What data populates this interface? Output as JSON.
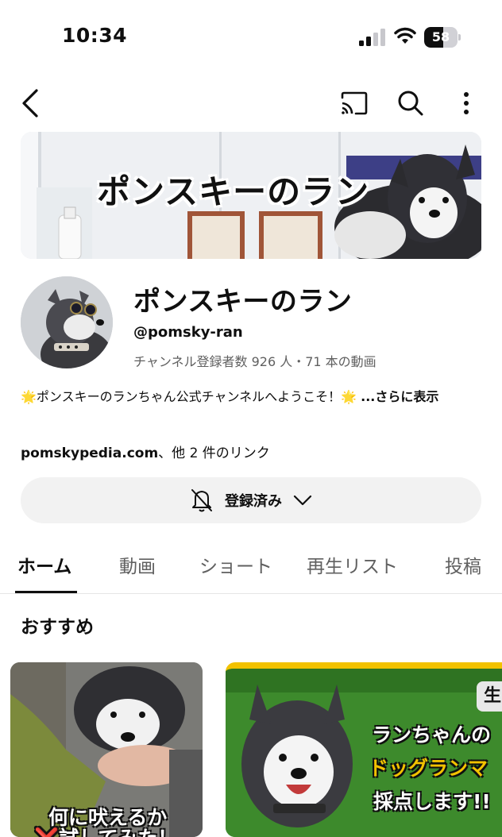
{
  "status_bar": {
    "time": "10:34",
    "battery": "58",
    "battery_level": 0.58
  },
  "banner": {
    "title": "ポンスキーのラン"
  },
  "channel": {
    "name": "ポンスキーのラン",
    "handle": "@pomsky-ran",
    "meta": "チャンネル登録者数 926 人・71 本の動画",
    "description": "🌟ポンスキーのランちゃん公式チャンネルへようこそ！🌟 ",
    "more": "...さらに表示",
    "link_main": "pomskypedia.com",
    "link_rest": "、他 2 件のリンク"
  },
  "subscribe_button": {
    "label": "登録済み"
  },
  "tabs": [
    {
      "label": "ホーム"
    },
    {
      "label": "動画"
    },
    {
      "label": "ショート"
    },
    {
      "label": "再生リスト"
    },
    {
      "label": "投稿"
    }
  ],
  "section": {
    "title": "おすすめ"
  },
  "videos": [
    {
      "overlay_line1": "何に吠えるか",
      "overlay_line2": "❌試してみた！"
    },
    {
      "badge": "生",
      "line1": "ランちゃんの",
      "line2": "ドッグランマ",
      "line3": "採点します!!"
    }
  ],
  "colors": {
    "accent": "#0f0f0f",
    "muted": "#606060",
    "button_bg": "#f2f2f2",
    "thumb_yellow": "#f2c200"
  }
}
